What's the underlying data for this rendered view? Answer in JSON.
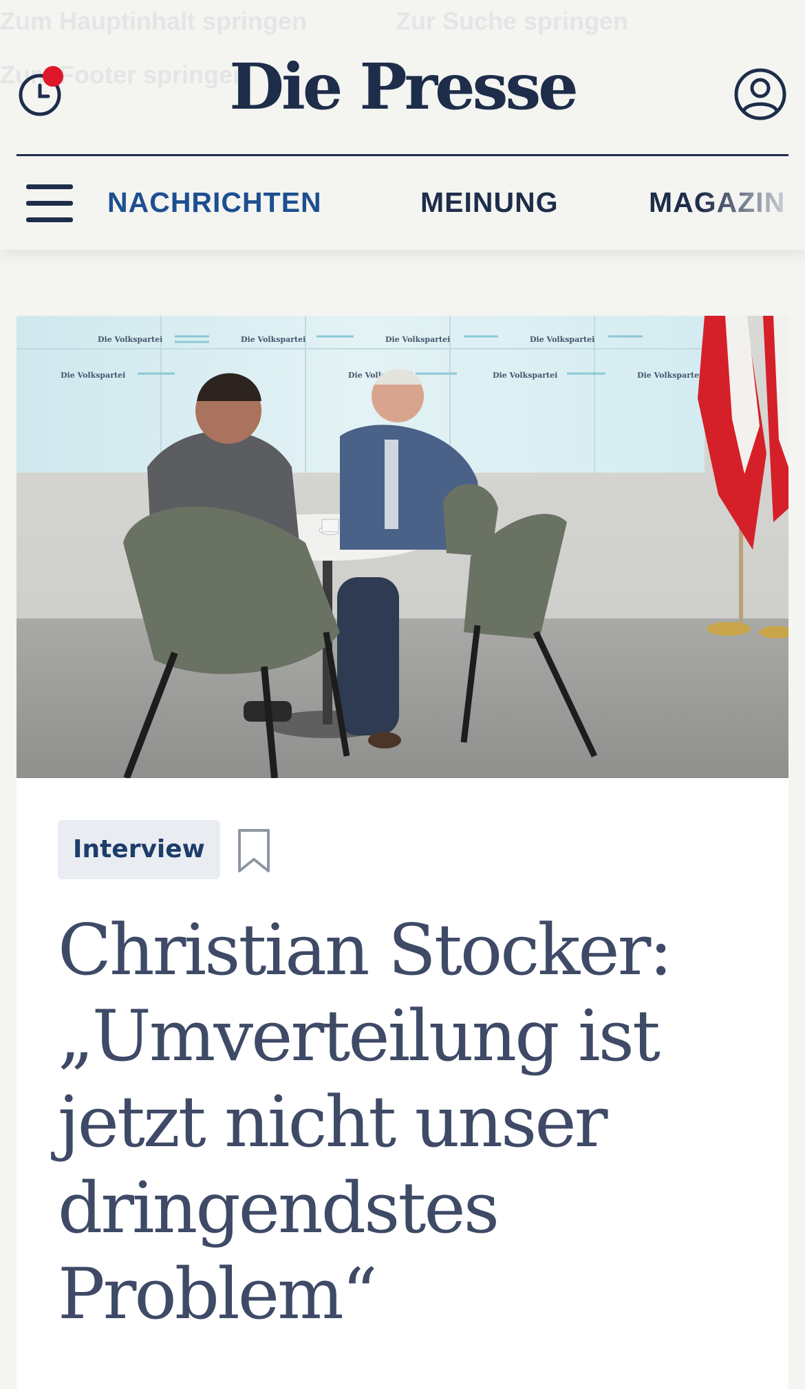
{
  "skip_links": {
    "main_content": "Zum Hauptinhalt springen",
    "search": "Zur Suche springen",
    "footer": "Zum Footer springen"
  },
  "header": {
    "logo": "Die Presse",
    "history_icon": "clock-history-icon",
    "account_icon": "user-account-icon",
    "notification_color": "#e0172a"
  },
  "nav": {
    "menu_icon": "hamburger-menu-icon",
    "items": [
      {
        "label": "NACHRICHTEN",
        "active": true
      },
      {
        "label": "MEINUNG",
        "active": false
      },
      {
        "label": "MAGAZIN",
        "active": false
      }
    ]
  },
  "article": {
    "tag": "Interview",
    "bookmark_icon": "bookmark-icon",
    "headline": "Christian Stocker: „Umverteilung ist jetzt nicht unser dringendstes Problem“",
    "image_wall_text": "Die Volkspartei"
  },
  "colors": {
    "brand_navy": "#1d2d4a",
    "active_nav": "#1d4f91",
    "headline": "#3e4a66",
    "tag_background": "#e9edf2",
    "page_background": "#f4f4f1"
  }
}
